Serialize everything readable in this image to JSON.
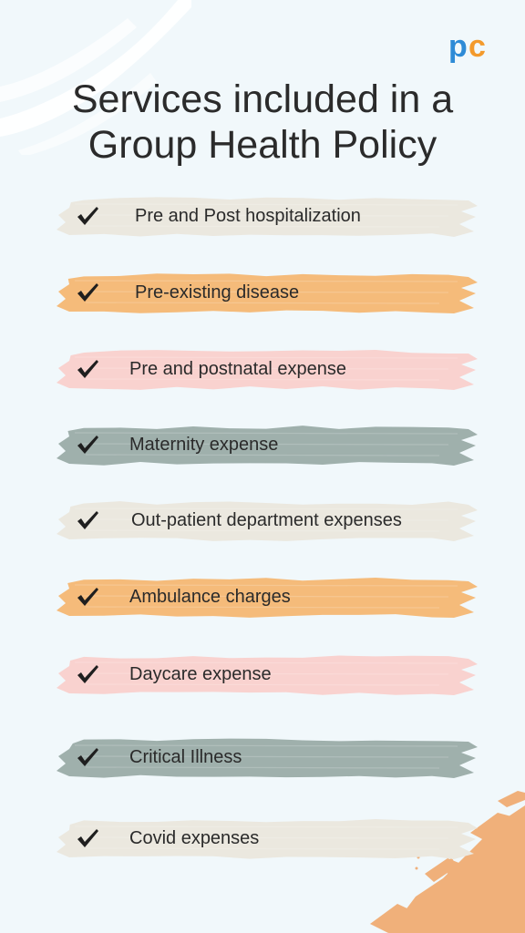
{
  "brand": {
    "logo_text": "pc",
    "colors": {
      "p": "#2e8bd6",
      "c": "#f39a2c"
    }
  },
  "title": {
    "line1": "Services included in a",
    "line2": "Group Health Policy"
  },
  "items": [
    {
      "label": "Pre and Post hospitalization",
      "color": "#ebe8df",
      "icon": "check-icon"
    },
    {
      "label": "Pre-existing disease",
      "color": "#f5bb7a",
      "icon": "check-icon"
    },
    {
      "label": "Pre and postnatal expense",
      "color": "#f9d2cf",
      "icon": "check-icon"
    },
    {
      "label": "Maternity expense",
      "color": "#9fb0ac",
      "icon": "check-icon"
    },
    {
      "label": "Out-patient department expenses",
      "color": "#ebe8df",
      "icon": "check-icon"
    },
    {
      "label": "Ambulance charges",
      "color": "#f5bb7a",
      "icon": "check-icon"
    },
    {
      "label": "Daycare expense",
      "color": "#f9d2cf",
      "icon": "check-icon"
    },
    {
      "label": "Critical Illness",
      "color": "#9fb0ac",
      "icon": "check-icon"
    },
    {
      "label": "Covid expenses",
      "color": "#ebe8df",
      "icon": "check-icon"
    }
  ],
  "decoration": {
    "top_left_stroke_color": "#ffffff",
    "bottom_right_paint_color": "#f0b07a"
  }
}
